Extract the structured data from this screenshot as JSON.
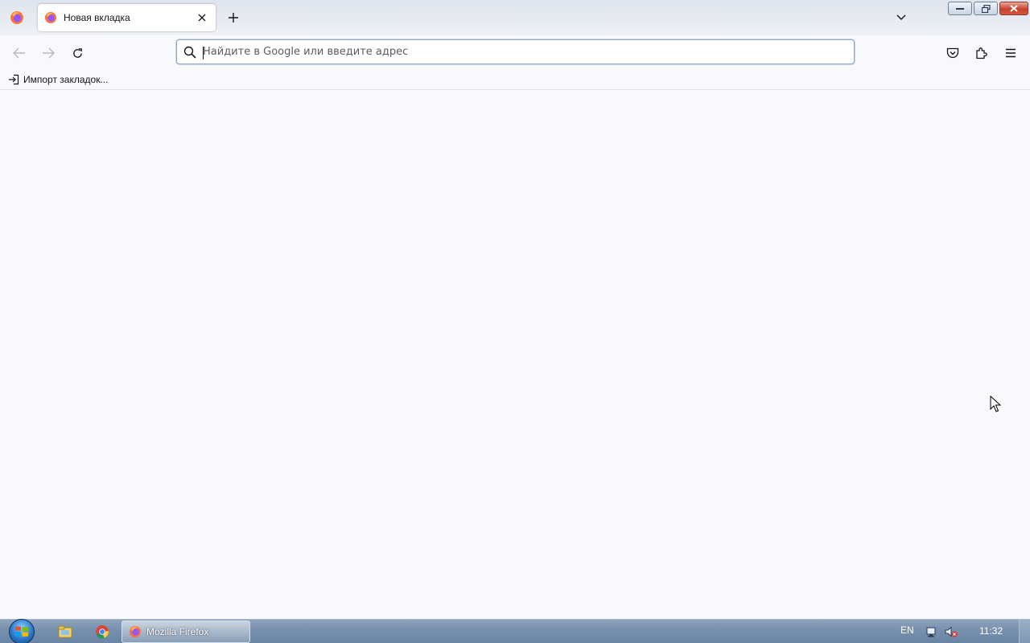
{
  "tabs": [
    {
      "title": "Новая вкладка",
      "favicon": "firefox-icon",
      "active": true
    }
  ],
  "urlbar": {
    "placeholder": "Найдите в Google или введите адрес",
    "value": ""
  },
  "bookmarks_toolbar": {
    "items": [
      {
        "label": "Импорт закладок...",
        "icon": "import-icon"
      }
    ]
  },
  "toolbar_icons": [
    "back-icon",
    "forward-icon",
    "reload-icon",
    "pocket-icon",
    "extensions-icon",
    "menu-icon"
  ],
  "taskbar": {
    "pinned": [
      "explorer-icon",
      "chrome-icon"
    ],
    "tasks": [
      {
        "label": "Mozilla Firefox",
        "icon": "firefox-icon"
      }
    ],
    "tray": {
      "language": "EN",
      "clock": "11:32"
    }
  },
  "colors": {
    "accent": "#0061e0",
    "content_bg": "#f9f9fb",
    "taskbar": "#7690ad"
  }
}
